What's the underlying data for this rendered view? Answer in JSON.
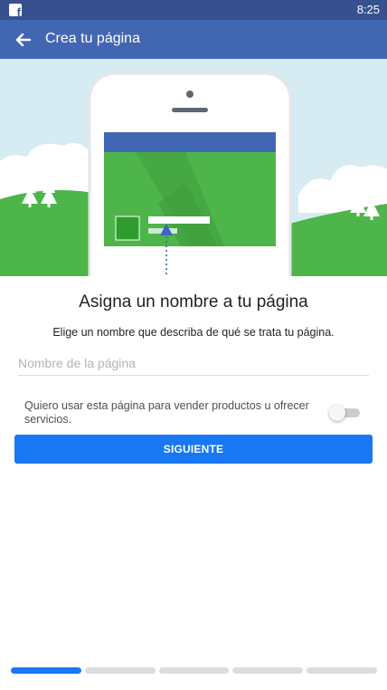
{
  "status_bar": {
    "time": "8:25",
    "app_icon": "facebook-icon"
  },
  "app_bar": {
    "back_icon": "arrow-left-icon",
    "title": "Crea tu página"
  },
  "hero": {
    "illustration": "phone-page-preview-illustration"
  },
  "content": {
    "title": "Asigna un nombre a tu página",
    "subtitle": "Elige un nombre que describa de qué se trata tu página.",
    "name_field": {
      "placeholder": "Nombre de la página",
      "value": ""
    },
    "sell_option": {
      "label": "Quiero usar esta página para vender productos u ofrecer servicios.",
      "enabled": false
    },
    "next_button": "SIGUIENTE"
  },
  "progress": {
    "current_step": 1,
    "total_steps": 5
  },
  "colors": {
    "status_bar": "#37508f",
    "app_bar": "#4267b2",
    "primary": "#1877f2",
    "sky": "#d6ecf2",
    "grass": "#4db54a"
  }
}
